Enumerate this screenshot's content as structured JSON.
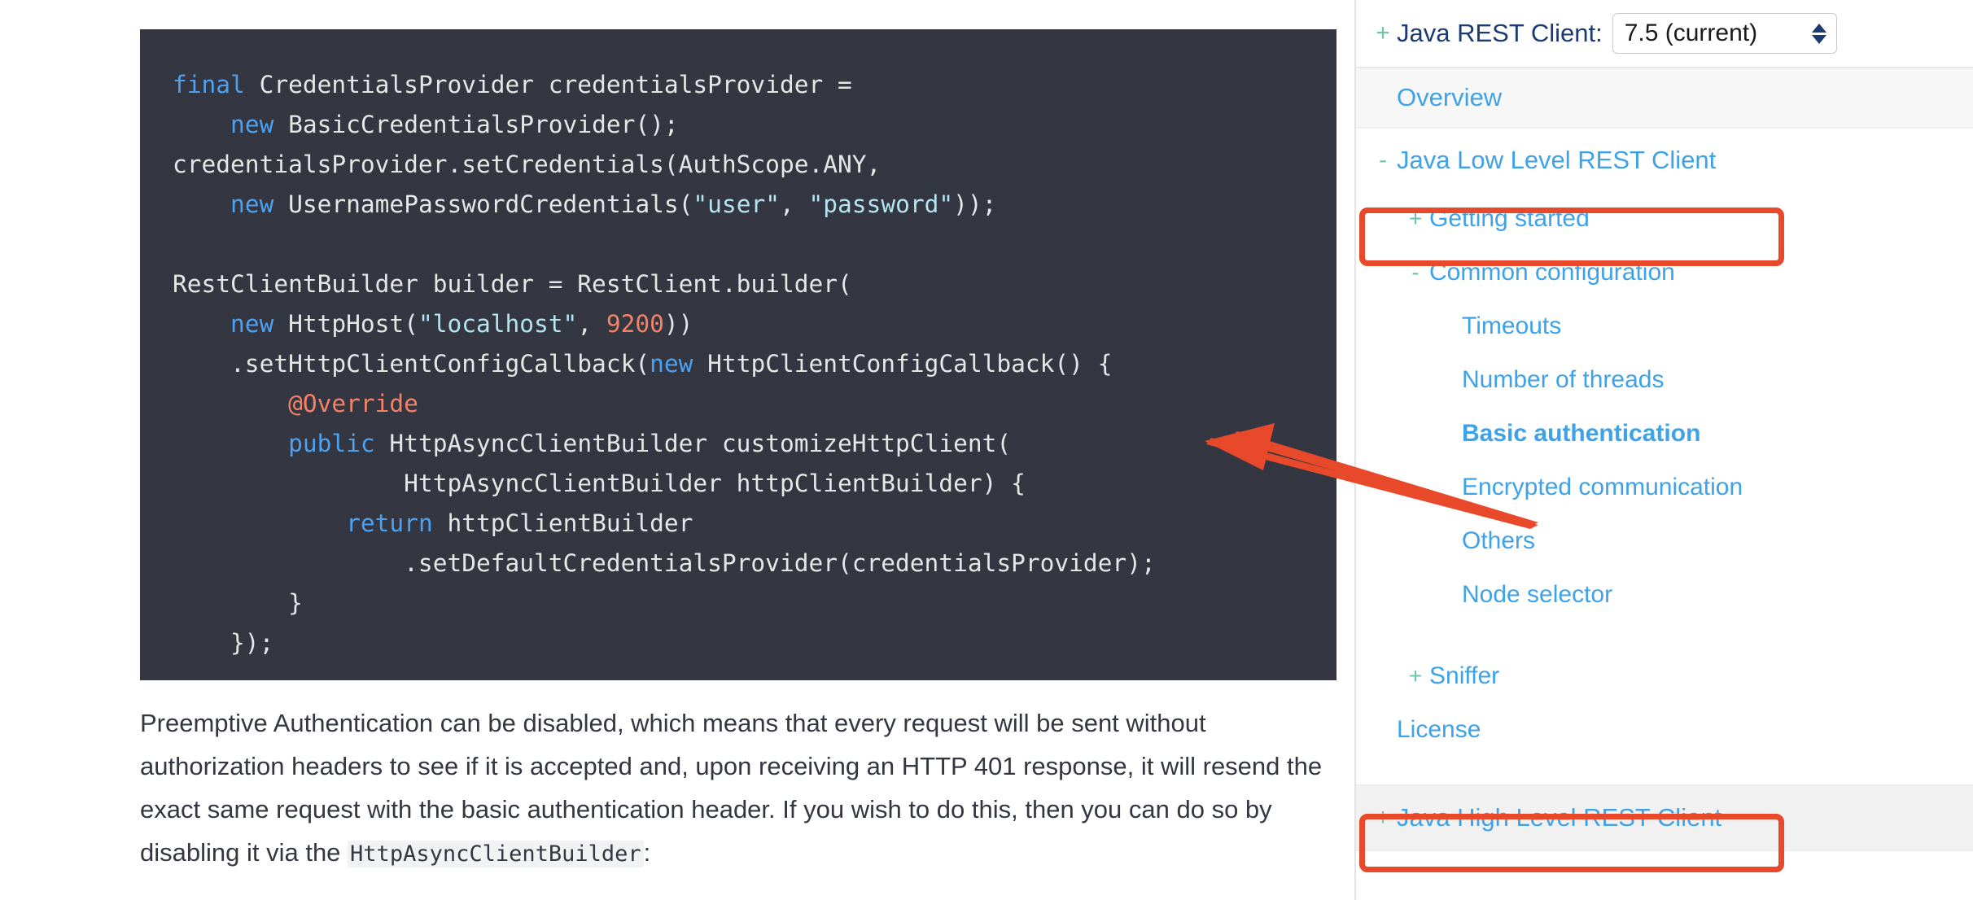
{
  "code_block": {
    "language": "java",
    "lines": [
      [
        {
          "t": "final",
          "c": "kw"
        },
        {
          "t": " CredentialsProvider credentialsProvider =",
          "c": "plain"
        }
      ],
      [
        {
          "t": "    ",
          "c": "plain"
        },
        {
          "t": "new",
          "c": "kw"
        },
        {
          "t": " BasicCredentialsProvider();",
          "c": "plain"
        }
      ],
      [
        {
          "t": "credentialsProvider.setCredentials(AuthScope.ANY,",
          "c": "plain"
        }
      ],
      [
        {
          "t": "    ",
          "c": "plain"
        },
        {
          "t": "new",
          "c": "kw"
        },
        {
          "t": " UsernamePasswordCredentials(",
          "c": "plain"
        },
        {
          "t": "\"user\"",
          "c": "str"
        },
        {
          "t": ", ",
          "c": "plain"
        },
        {
          "t": "\"password\"",
          "c": "str"
        },
        {
          "t": "));",
          "c": "plain"
        }
      ],
      [
        {
          "t": "",
          "c": "plain"
        }
      ],
      [
        {
          "t": "RestClientBuilder builder = RestClient.builder(",
          "c": "plain"
        }
      ],
      [
        {
          "t": "    ",
          "c": "plain"
        },
        {
          "t": "new",
          "c": "kw"
        },
        {
          "t": " HttpHost(",
          "c": "plain"
        },
        {
          "t": "\"localhost\"",
          "c": "str"
        },
        {
          "t": ", ",
          "c": "plain"
        },
        {
          "t": "9200",
          "c": "num"
        },
        {
          "t": "))",
          "c": "plain"
        }
      ],
      [
        {
          "t": "    .setHttpClientConfigCallback(",
          "c": "plain"
        },
        {
          "t": "new",
          "c": "kw"
        },
        {
          "t": " HttpClientConfigCallback() {",
          "c": "plain"
        }
      ],
      [
        {
          "t": "        ",
          "c": "plain"
        },
        {
          "t": "@Override",
          "c": "ann"
        }
      ],
      [
        {
          "t": "        ",
          "c": "plain"
        },
        {
          "t": "public",
          "c": "kw"
        },
        {
          "t": " HttpAsyncClientBuilder customizeHttpClient(",
          "c": "plain"
        }
      ],
      [
        {
          "t": "                HttpAsyncClientBuilder httpClientBuilder) {",
          "c": "plain"
        }
      ],
      [
        {
          "t": "            ",
          "c": "plain"
        },
        {
          "t": "return",
          "c": "kw"
        },
        {
          "t": " httpClientBuilder",
          "c": "plain"
        }
      ],
      [
        {
          "t": "                .setDefaultCredentialsProvider(credentialsProvider);",
          "c": "plain"
        }
      ],
      [
        {
          "t": "        }",
          "c": "plain"
        }
      ],
      [
        {
          "t": "    });",
          "c": "plain"
        }
      ]
    ]
  },
  "paragraph": {
    "part1": "Preemptive Authentication can be disabled, which means that every request will be sent without authorization headers to see if it is accepted and, upon receiving an HTTP 401 response, it will resend the exact same request with the basic authentication header. If you wish to do this, then you can do so by disabling it via the ",
    "code": "HttpAsyncClientBuilder",
    "part2": ":"
  },
  "sidebar": {
    "version_row": {
      "toggle": "+",
      "label": "Java REST Client:",
      "selected_version": "7.5 (current)",
      "spinner_icon": "stepper-up-down-icon"
    },
    "overview": {
      "label": "Overview"
    },
    "low_level": {
      "toggle": "-",
      "label": "Java Low Level REST Client",
      "children": [
        {
          "toggle": "+",
          "label": "Getting started",
          "level": 2,
          "active": false
        },
        {
          "toggle": "-",
          "label": "Common configuration",
          "level": 2,
          "active": false
        },
        {
          "toggle": "",
          "label": "Timeouts",
          "level": 3,
          "active": false
        },
        {
          "toggle": "",
          "label": "Number of threads",
          "level": 3,
          "active": false
        },
        {
          "toggle": "",
          "label": "Basic authentication",
          "level": 3,
          "active": true
        },
        {
          "toggle": "",
          "label": "Encrypted communication",
          "level": 3,
          "active": false
        },
        {
          "toggle": "",
          "label": "Others",
          "level": 3,
          "active": false
        },
        {
          "toggle": "",
          "label": "Node selector",
          "level": 3,
          "active": false
        }
      ],
      "footer_items": [
        {
          "toggle": "+",
          "label": "Sniffer",
          "level": 2
        },
        {
          "toggle": "",
          "label": "License",
          "level": 2
        }
      ]
    },
    "high_level": {
      "toggle": "+",
      "label": "Java High Level REST Client"
    }
  },
  "annotations": {
    "highlight_color": "#e8492a",
    "boxes": [
      {
        "name": "highlight-java-low-level-rest-client"
      },
      {
        "name": "highlight-java-high-level-rest-client"
      }
    ],
    "arrow": {
      "name": "pointer-arrow-to-basic-authentication"
    }
  },
  "colors": {
    "code_background": "#343741",
    "keyword": "#4da1f0",
    "string": "#b3e4f0",
    "number": "#f2836b",
    "annotation": "#f2836b",
    "link": "#3ea2e8",
    "toggle_green": "#6ec5a8",
    "version_label": "#1c3b70",
    "accent_red": "#e8492a"
  }
}
